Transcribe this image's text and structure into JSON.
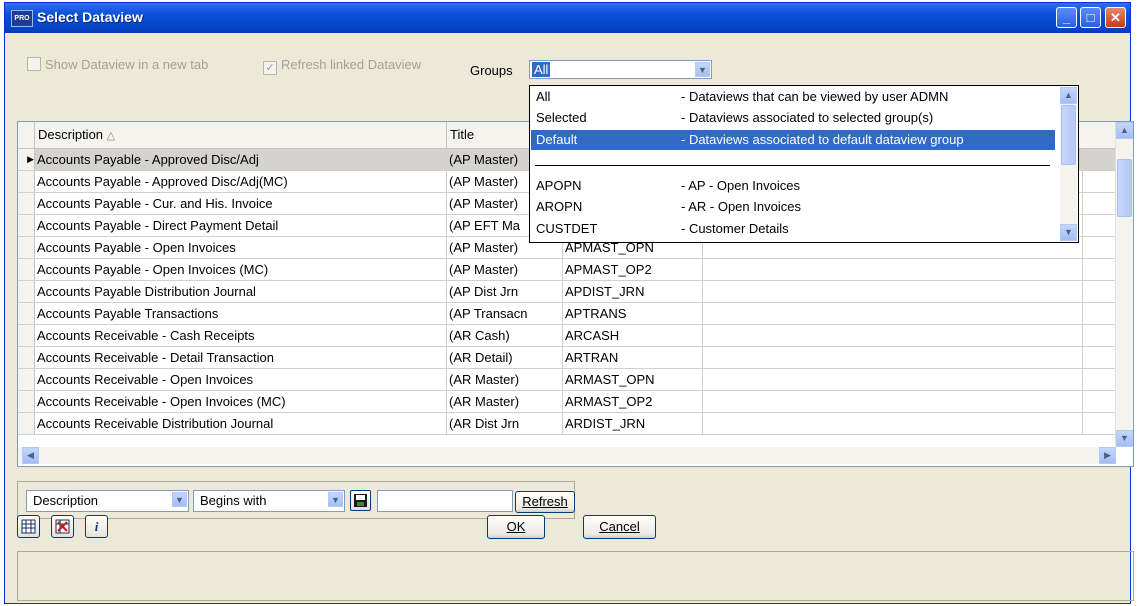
{
  "window": {
    "title": "Select Dataview",
    "icon_label": "PRO"
  },
  "options": {
    "show_new_tab_label": "Show Dataview in a new tab",
    "show_new_tab_checked": false,
    "refresh_linked_label": "Refresh linked Dataview",
    "refresh_linked_checked": true,
    "groups_label": "Groups",
    "groups_value": "All"
  },
  "groups_dropdown": {
    "items": [
      {
        "code": "All",
        "desc": "- Dataviews that can be viewed by user ADMN"
      },
      {
        "code": "Selected",
        "desc": "- Dataviews associated to selected group(s)"
      },
      {
        "code": "Default",
        "desc": "- Dataviews associated to default dataview group",
        "selected": true
      },
      {
        "code": "",
        "desc": ""
      },
      {
        "code": "APOPN",
        "desc": "- AP - Open Invoices"
      },
      {
        "code": "AROPN",
        "desc": "- AR - Open Invoices"
      },
      {
        "code": "CUSTDET",
        "desc": "- Customer Details"
      }
    ]
  },
  "grid": {
    "columns": [
      "Description",
      "Title"
    ],
    "sort_indicator": "△",
    "rows": [
      {
        "desc": "Accounts Payable - Approved Disc/Adj",
        "title": "(AP Master)",
        "name": ""
      },
      {
        "desc": "Accounts Payable - Approved Disc/Adj(MC)",
        "title": "(AP Master)",
        "name": ""
      },
      {
        "desc": "Accounts Payable - Cur. and His. Invoice",
        "title": "(AP Master)",
        "name": ""
      },
      {
        "desc": "Accounts Payable - Direct Payment Detail",
        "title": "(AP EFT Ma",
        "name": ""
      },
      {
        "desc": "Accounts Payable - Open Invoices",
        "title": "(AP Master)",
        "name": "APMAST_OPN"
      },
      {
        "desc": "Accounts Payable - Open Invoices (MC)",
        "title": "(AP Master)",
        "name": "APMAST_OP2"
      },
      {
        "desc": "Accounts Payable Distribution Journal",
        "title": "(AP Dist Jrn",
        "name": "APDIST_JRN"
      },
      {
        "desc": "Accounts Payable Transactions",
        "title": "(AP Transacn",
        "name": "APTRANS"
      },
      {
        "desc": "Accounts Receivable - Cash Receipts",
        "title": "(AR Cash)",
        "name": "ARCASH"
      },
      {
        "desc": "Accounts Receivable - Detail Transaction",
        "title": "(AR Detail)",
        "name": "ARTRAN"
      },
      {
        "desc": "Accounts Receivable - Open Invoices",
        "title": "(AR Master)",
        "name": "ARMAST_OPN"
      },
      {
        "desc": "Accounts Receivable - Open Invoices (MC)",
        "title": "(AR Master)",
        "name": "ARMAST_OP2"
      },
      {
        "desc": "Accounts Receivable Distribution Journal",
        "title": "(AR Dist Jrn",
        "name": "ARDIST_JRN"
      }
    ]
  },
  "filter": {
    "field_value": "Description",
    "operator_value": "Begins with",
    "search_value": "",
    "refresh_label": "Refresh"
  },
  "buttons": {
    "ok_label": "OK",
    "cancel_label": "Cancel"
  }
}
